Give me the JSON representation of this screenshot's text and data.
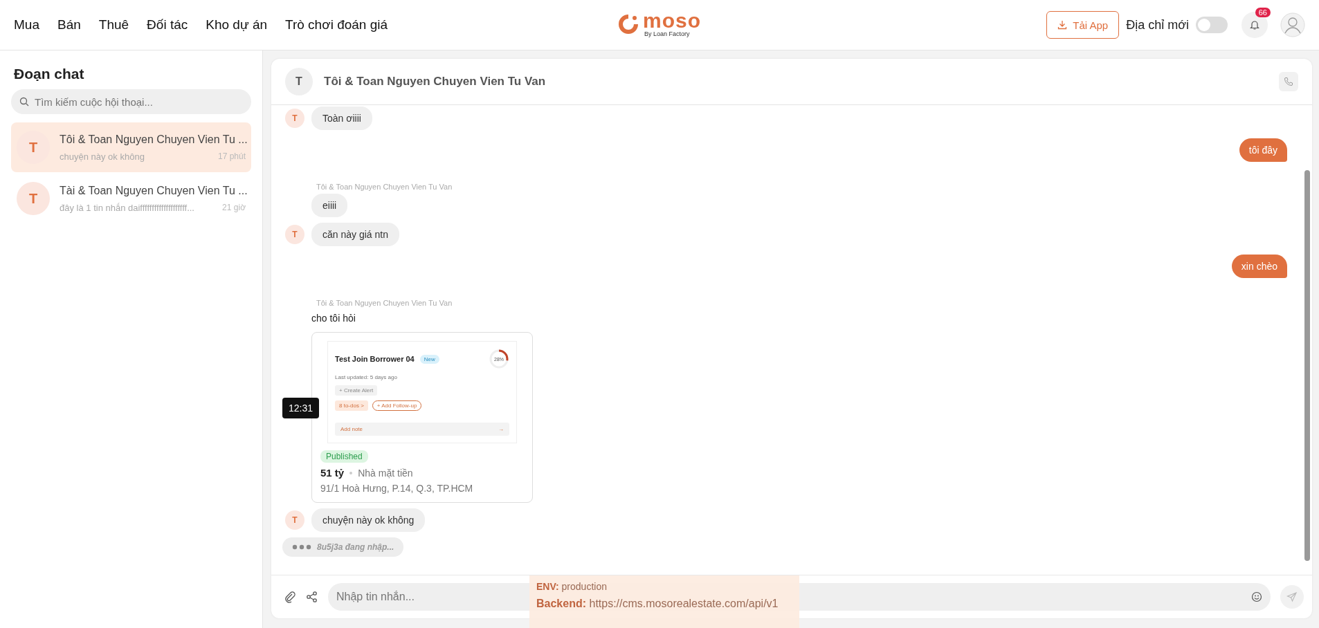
{
  "nav": [
    "Mua",
    "Bán",
    "Thuê",
    "Đối tác",
    "Kho dự án",
    "Trò chơi đoán giá"
  ],
  "logo": {
    "text": "moso",
    "tagline": "By Loan Factory"
  },
  "actions": {
    "download": "Tải App",
    "toggle": {
      "label": "Địa chỉ mới",
      "on": false
    },
    "notifications": "66"
  },
  "sidebar": {
    "title": "Đoạn chat",
    "search": {
      "placeholder": "Tìm kiếm cuộc hội thoại..."
    },
    "conversations": [
      {
        "avatar": "T",
        "name": "Tôi & Toan Nguyen Chuyen Vien Tu ...",
        "preview": "chuyện này ok không",
        "time": "17 phút",
        "selected": true
      },
      {
        "avatar": "T",
        "name": "Tài & Toan Nguyen Chuyen Vien Tu ...",
        "preview": "đây là 1 tin nhắn daiffffffffffffffffffff...",
        "time": "21 giờ",
        "selected": false
      }
    ]
  },
  "chat": {
    "avatar": "T",
    "title": "Tôi & Toan Nguyen Chuyen Vien Tu Van",
    "messages": [
      {
        "kind": "incoming",
        "avatar": "T",
        "text": "Toàn ơiiii"
      },
      {
        "kind": "outgoing",
        "text": "tôi đây"
      },
      {
        "kind": "incoming",
        "sender": "Tôi & Toan Nguyen Chuyen Vien Tu Van",
        "text": "eiiii"
      },
      {
        "kind": "incoming",
        "avatar": "T",
        "text": "căn này giá ntn"
      },
      {
        "kind": "outgoing",
        "text": "xin chèo"
      },
      {
        "kind": "plain",
        "sender": "Tôi & Toan Nguyen Chuyen Vien Tu Van",
        "text": "cho tôi hỏi"
      },
      {
        "kind": "listing",
        "time": "12:31",
        "preview": {
          "title": "Test Join Borrower 04",
          "badge": "New",
          "progress": "28%",
          "level": 0.28,
          "updated": "Last updated: 5 days ago",
          "alert": "+ Create Alert",
          "todos": "8 to-dos >",
          "follow": "+ Add Follow-up",
          "note": "Add note",
          "arrow": "→"
        },
        "status": "Published",
        "price": "51 tỷ",
        "type": "Nhà mặt tiền",
        "address": "91/1 Hoà Hưng, P.14, Q.3, TP.HCM"
      },
      {
        "kind": "incoming",
        "avatar": "T",
        "text": "chuyện này ok không"
      }
    ],
    "typing": "8u5j3a đang nhập...",
    "composer": {
      "placeholder": "Nhập tin nhắn..."
    }
  },
  "env": {
    "env": "**ENV:** production",
    "backend": "**Backend:** https://cms.mosorealestate.com/api/v1"
  }
}
